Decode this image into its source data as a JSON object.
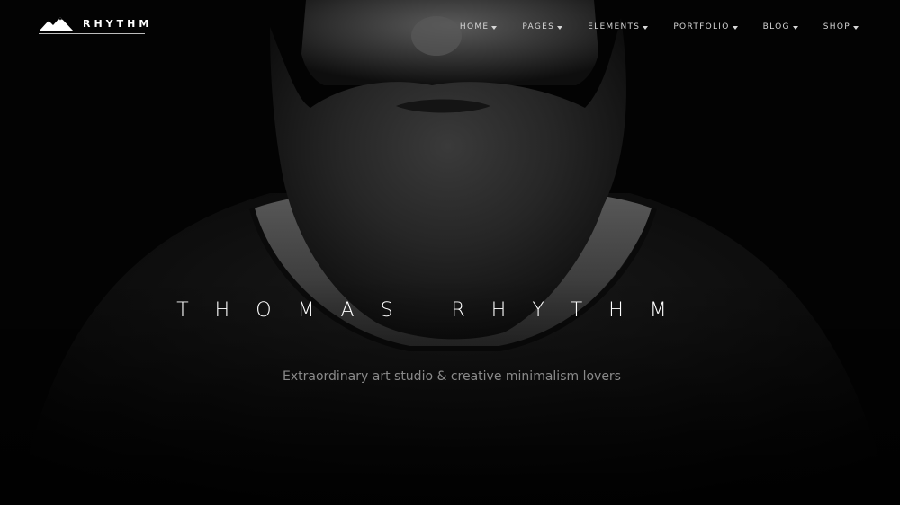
{
  "brand": {
    "name": "RHYTHM",
    "logo_icon": "mountains-icon"
  },
  "nav": {
    "items": [
      {
        "label": "HOME",
        "icon": "caret-down-icon"
      },
      {
        "label": "PAGES",
        "icon": "caret-down-icon"
      },
      {
        "label": "ELEMENTS",
        "icon": "caret-down-icon"
      },
      {
        "label": "PORTFOLIO",
        "icon": "caret-down-icon"
      },
      {
        "label": "BLOG",
        "icon": "caret-down-icon"
      },
      {
        "label": "SHOP",
        "icon": "caret-down-icon"
      }
    ]
  },
  "hero": {
    "title": "THOMAS RHYTHM",
    "subtitle": "Extraordinary art studio & creative minimalism lovers",
    "background": "bearded-man-portrait"
  },
  "colors": {
    "background": "#000000",
    "title": "#ffffff",
    "subtitle": "#8a8a8a",
    "nav_text": "#d6d6d6"
  }
}
